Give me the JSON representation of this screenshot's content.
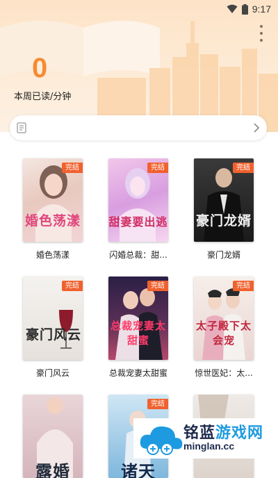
{
  "status_bar": {
    "time": "9:17",
    "icons": [
      "wifi-icon",
      "battery-icon"
    ]
  },
  "header": {
    "weekly_read_value": "0",
    "weekly_read_label": "本周已读/分钟",
    "accent_color": "#f58b32"
  },
  "search": {
    "placeholder": ""
  },
  "books": [
    {
      "title": "婚色荡漾",
      "cover_text": "婚色荡漾",
      "badge": "完结"
    },
    {
      "title": "闪婚总裁：甜...",
      "cover_text": "甜妻要出逃",
      "badge": "完结"
    },
    {
      "title": "豪门龙婿",
      "cover_text": "豪门龙婿",
      "badge": "完结"
    },
    {
      "title": "豪门风云",
      "cover_text": "豪门风云",
      "badge": "完结"
    },
    {
      "title": "总裁宠妻太甜蜜",
      "cover_text": "总裁宠妻太甜蜜",
      "badge": "完结"
    },
    {
      "title": "惊世医妃：太...",
      "cover_text": "太子殿下太会宠",
      "badge": "完结"
    },
    {
      "title": "",
      "cover_text": "露婚",
      "badge": ""
    },
    {
      "title": "",
      "cover_text": "诸天",
      "badge": "完结"
    },
    {
      "title": "",
      "cover_text": "",
      "badge": ""
    }
  ],
  "watermark": {
    "cn_part1": "铭蓝",
    "cn_part2": "游戏网",
    "en": "minglan.cc"
  }
}
